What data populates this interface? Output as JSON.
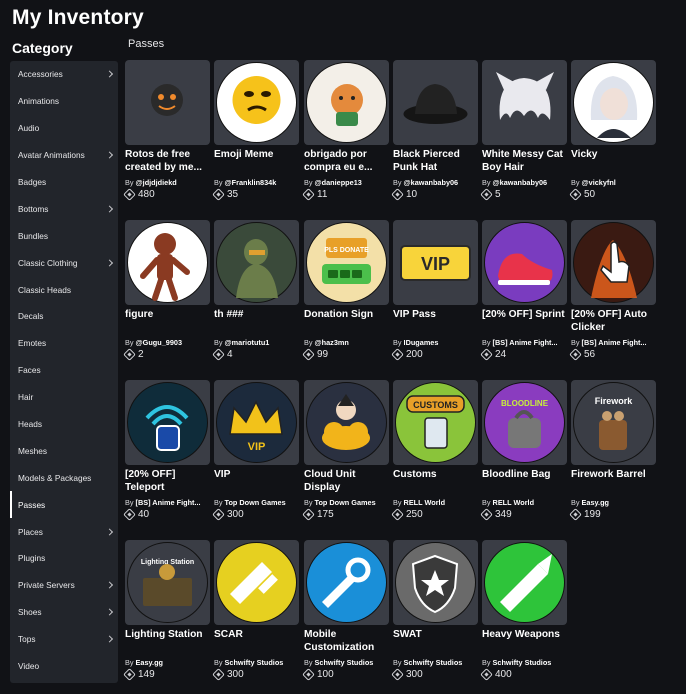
{
  "header": {
    "title": "My Inventory",
    "category_heading": "Category",
    "section": "Passes"
  },
  "sidebar": {
    "items": [
      {
        "label": "Accessories",
        "chevron": true
      },
      {
        "label": "Animations",
        "chevron": false
      },
      {
        "label": "Audio",
        "chevron": false
      },
      {
        "label": "Avatar Animations",
        "chevron": true
      },
      {
        "label": "Badges",
        "chevron": false
      },
      {
        "label": "Bottoms",
        "chevron": true
      },
      {
        "label": "Bundles",
        "chevron": false
      },
      {
        "label": "Classic Clothing",
        "chevron": true
      },
      {
        "label": "Classic Heads",
        "chevron": false
      },
      {
        "label": "Decals",
        "chevron": false
      },
      {
        "label": "Emotes",
        "chevron": false
      },
      {
        "label": "Faces",
        "chevron": false
      },
      {
        "label": "Hair",
        "chevron": false
      },
      {
        "label": "Heads",
        "chevron": false
      },
      {
        "label": "Meshes",
        "chevron": false
      },
      {
        "label": "Models & Packages",
        "chevron": false
      },
      {
        "label": "Passes",
        "chevron": false,
        "active": true
      },
      {
        "label": "Places",
        "chevron": true
      },
      {
        "label": "Plugins",
        "chevron": false
      },
      {
        "label": "Private Servers",
        "chevron": true
      },
      {
        "label": "Shoes",
        "chevron": true
      },
      {
        "label": "Tops",
        "chevron": true
      },
      {
        "label": "Video",
        "chevron": false
      }
    ]
  },
  "items": [
    {
      "name": "Rotos de free created by me...",
      "by": "By",
      "creator": "@jdjdjdiekd",
      "price": "480",
      "icon": "face-cartoon-icon",
      "bg": "#3a3d45",
      "accent": "#f08a2c"
    },
    {
      "name": "Emoji Meme",
      "by": "By",
      "creator": "@Franklin834k",
      "price": "35",
      "icon": "emoji-icon",
      "bg": "#ffffff",
      "accent": "#f6c21a"
    },
    {
      "name": "obrigado por compra eu e...",
      "by": "By",
      "creator": "@danieppe13",
      "price": "11",
      "icon": "cat-drawing-icon",
      "bg": "#f3efe8",
      "accent": "#e48a3c"
    },
    {
      "name": "Black Pierced Punk Hat",
      "by": "By",
      "creator": "@kawanbaby06",
      "price": "10",
      "icon": "hat-icon",
      "bg": "#3a3d45",
      "accent": "#151515"
    },
    {
      "name": "White Messy Cat Boy Hair",
      "by": "By",
      "creator": "@kawanbaby06",
      "price": "5",
      "icon": "hair-icon",
      "bg": "#3a3d45",
      "accent": "#e9e9ee"
    },
    {
      "name": "Vicky",
      "by": "By",
      "creator": "@vickyfnl",
      "price": "50",
      "icon": "anime-portrait-icon",
      "bg": "#ffffff",
      "accent": "#9aa3b8"
    },
    {
      "name": "figure",
      "by": "By",
      "creator": "@Gugu_9903",
      "price": "2",
      "icon": "figure-icon",
      "bg": "#ffffff",
      "accent": "#8a3a22"
    },
    {
      "name": "th ###",
      "by": "By",
      "creator": "@mariotutu1",
      "price": "4",
      "icon": "soldier-icon",
      "bg": "#3a4a3a",
      "accent": "#6b7d4a"
    },
    {
      "name": "Donation Sign",
      "by": "By",
      "creator": "@haz3mn",
      "price": "99",
      "icon": "donate-sign-icon",
      "bg": "#f3e0a8",
      "accent": "#4bbf4b",
      "sign": "PLS DONATE"
    },
    {
      "name": "VIP Pass",
      "by": "By",
      "creator": "IDugames",
      "price": "200",
      "icon": "vip-ticket-icon",
      "bg": "#3a3d45",
      "accent": "#f8d43a",
      "sign": "VIP"
    },
    {
      "name": "[20% OFF] Sprint",
      "by": "By",
      "creator": "[BS] Anime Fight...",
      "price": "24",
      "icon": "shoe-icon",
      "bg": "#7a3cbf",
      "accent": "#e8334a"
    },
    {
      "name": "[20% OFF] Auto Clicker",
      "by": "By",
      "creator": "[BS] Anime Fight...",
      "price": "56",
      "icon": "hand-cursor-icon",
      "bg": "#3a1a12",
      "accent": "#f0651e"
    },
    {
      "name": "[20% OFF] Teleport",
      "by": "By",
      "creator": "[BS] Anime Fight...",
      "price": "40",
      "icon": "teleport-icon",
      "bg": "#0f2c3a",
      "accent": "#2ec4e0"
    },
    {
      "name": "VIP",
      "by": "By",
      "creator": "Top Down Games",
      "price": "300",
      "icon": "crown-icon",
      "bg": "#1c2a3c",
      "accent": "#f2c21a",
      "sign": "VIP"
    },
    {
      "name": "Cloud Unit Display",
      "by": "By",
      "creator": "Top Down Games",
      "price": "175",
      "icon": "cloud-unit-icon",
      "bg": "#2a3040",
      "accent": "#f2b41a"
    },
    {
      "name": "Customs",
      "by": "By",
      "creator": "RELL World",
      "price": "250",
      "icon": "customs-badge-icon",
      "bg": "#8ac43a",
      "accent": "#e8a028",
      "sign": "CUSTOMS"
    },
    {
      "name": "Bloodline Bag",
      "by": "By",
      "creator": "RELL World",
      "price": "349",
      "icon": "bloodline-bag-icon",
      "bg": "#8a3cbf",
      "accent": "#c8f03a",
      "sign": "BLOODLINE"
    },
    {
      "name": "Firework Barrel",
      "by": "By",
      "creator": "Easy.gg",
      "price": "199",
      "icon": "firework-barrel-icon",
      "bg": "#3a3d45",
      "accent": "#c8a070",
      "sign": "Firework"
    },
    {
      "name": "Lighting Station",
      "by": "By",
      "creator": "Easy.gg",
      "price": "149",
      "icon": "lighting-station-icon",
      "bg": "#3a3d45",
      "accent": "#c89a3a",
      "sign": "Lighting Station"
    },
    {
      "name": "SCAR",
      "by": "By",
      "creator": "Schwifty Studios",
      "price": "300",
      "icon": "rifle-icon",
      "bg": "#e6d020",
      "accent": "#ffffff"
    },
    {
      "name": "Mobile Customization",
      "by": "By",
      "creator": "Schwifty Studios",
      "price": "100",
      "icon": "wrench-gun-icon",
      "bg": "#1a8fd8",
      "accent": "#ffffff"
    },
    {
      "name": "SWAT",
      "by": "By",
      "creator": "Schwifty Studios",
      "price": "300",
      "icon": "swat-shield-icon",
      "bg": "#6a6a6a",
      "accent": "#ffffff"
    },
    {
      "name": "Heavy Weapons",
      "by": "By",
      "creator": "Schwifty Studios",
      "price": "400",
      "icon": "launcher-icon",
      "bg": "#2ec43a",
      "accent": "#ffffff"
    }
  ]
}
